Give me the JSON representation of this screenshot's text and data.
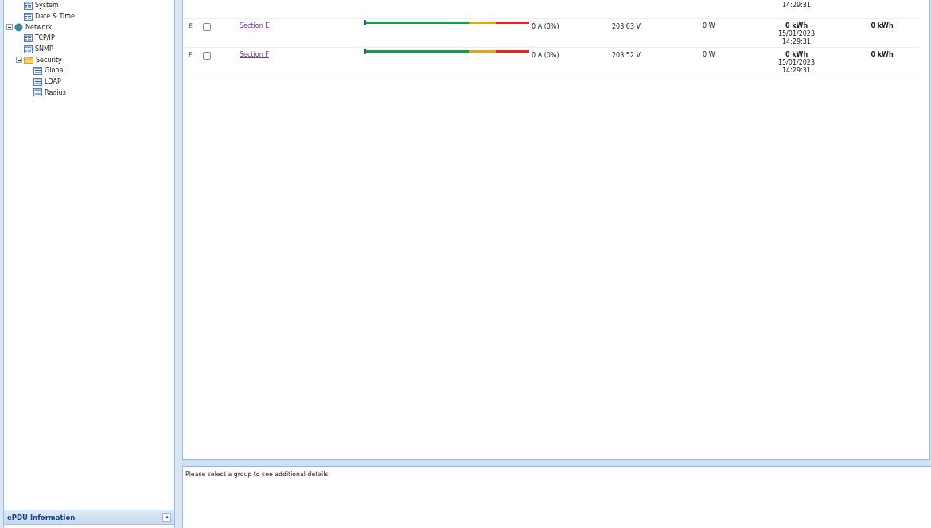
{
  "tree_top": [
    {
      "label": "System",
      "kind": "page"
    },
    {
      "label": "Date & Time",
      "kind": "page"
    }
  ],
  "tree": [
    {
      "label": "Network",
      "kind": "globe",
      "expanded": true,
      "children": [
        {
          "label": "TCP/IP",
          "kind": "page"
        },
        {
          "label": "SNMP",
          "kind": "page"
        },
        {
          "label": "Security",
          "kind": "folder",
          "expanded": true,
          "children": [
            {
              "label": "Global",
              "kind": "page"
            },
            {
              "label": "LDAP",
              "kind": "page"
            },
            {
              "label": "Radius",
              "kind": "page"
            }
          ]
        }
      ]
    }
  ],
  "info_panel": {
    "title": "ePDU Information",
    "collapsed": false
  },
  "rows": [
    {
      "energy_time": "14:29:31"
    },
    {
      "letter": "E",
      "checked": false,
      "name": "Section E",
      "level": 0,
      "current": "0 A (0%)",
      "voltage": "203.63 V",
      "power": "0 W",
      "energy": "0 kWh",
      "energy_date": "15/01/2023",
      "energy_time": "14:29:31",
      "last_energy": "0 kWh"
    },
    {
      "letter": "F",
      "checked": false,
      "name": "Section F",
      "level": 0,
      "current": "0 A (0%)",
      "voltage": "203.52 V",
      "power": "0 W",
      "energy": "0 kWh",
      "energy_date": "15/01/2023",
      "energy_time": "14:29:31",
      "last_energy": "0 kWh"
    }
  ],
  "details": {
    "message": "Please select a group to see additional details."
  }
}
